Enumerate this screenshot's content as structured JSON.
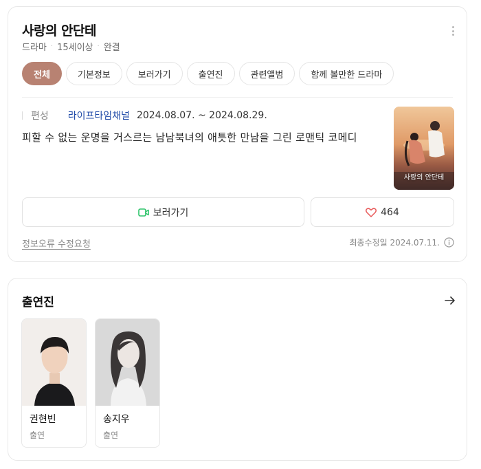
{
  "show": {
    "title": "사랑의 안단테",
    "meta": [
      "드라마",
      "15세이상",
      "완결"
    ]
  },
  "tabs": [
    {
      "label": "전체",
      "active": true
    },
    {
      "label": "기본정보",
      "active": false
    },
    {
      "label": "보러가기",
      "active": false
    },
    {
      "label": "출연진",
      "active": false
    },
    {
      "label": "관련앨범",
      "active": false
    },
    {
      "label": "함께 볼만한 드라마",
      "active": false
    }
  ],
  "info": {
    "label": "편성",
    "channel": "라이프타임채널",
    "dates": "2024.08.07. ~ 2024.08.29.",
    "description": "피할 수 없는 운명을 거스르는 남남북녀의 애틋한 만남을 그린 로맨틱 코메디"
  },
  "poster": {
    "title_art": "사랑의 안단테"
  },
  "actions": {
    "watch_label": "보러가기",
    "like_count": "464"
  },
  "footer": {
    "report_link": "정보오류 수정요청",
    "last_modified": "최종수정일 2024.07.11."
  },
  "cast_section": {
    "title": "출연진",
    "members": [
      {
        "name": "권현빈",
        "role": "출연"
      },
      {
        "name": "송지우",
        "role": "출연"
      }
    ]
  },
  "colors": {
    "accent": "#b88272",
    "link": "#1f4aa8",
    "like": "#e85a5a",
    "watch_icon": "#2ec46b"
  }
}
